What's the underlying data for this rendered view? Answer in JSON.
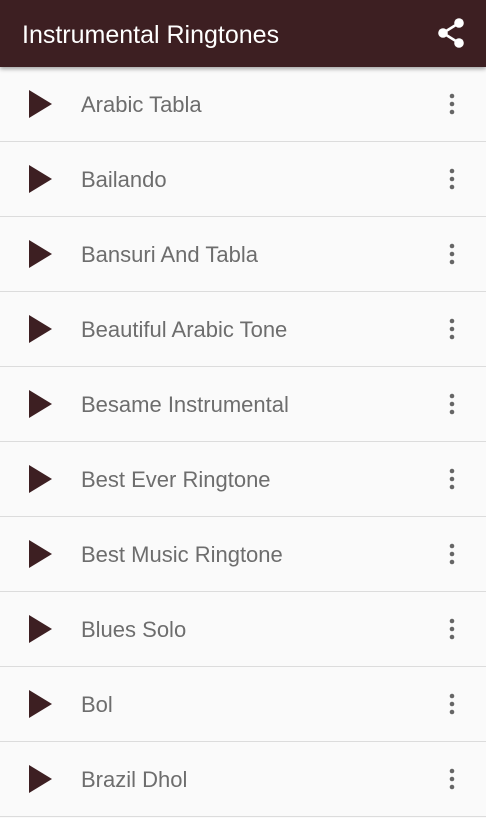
{
  "appbar": {
    "title": "Instrumental Ringtones",
    "share_icon": "share-icon",
    "background": "#3d1f22"
  },
  "ringtones": [
    {
      "title": "Arabic Tabla"
    },
    {
      "title": "Bailando"
    },
    {
      "title": "Bansuri And Tabla"
    },
    {
      "title": "Beautiful Arabic Tone"
    },
    {
      "title": "Besame Instrumental"
    },
    {
      "title": "Best Ever Ringtone"
    },
    {
      "title": "Best Music Ringtone"
    },
    {
      "title": "Blues Solo"
    },
    {
      "title": "Bol"
    },
    {
      "title": "Brazil Dhol"
    }
  ],
  "icons": {
    "play": "play-icon",
    "more": "more-vertical-icon"
  },
  "colors": {
    "accent": "#3d1f22",
    "text": "#6d6d6d",
    "divider": "#dcdcdc"
  }
}
